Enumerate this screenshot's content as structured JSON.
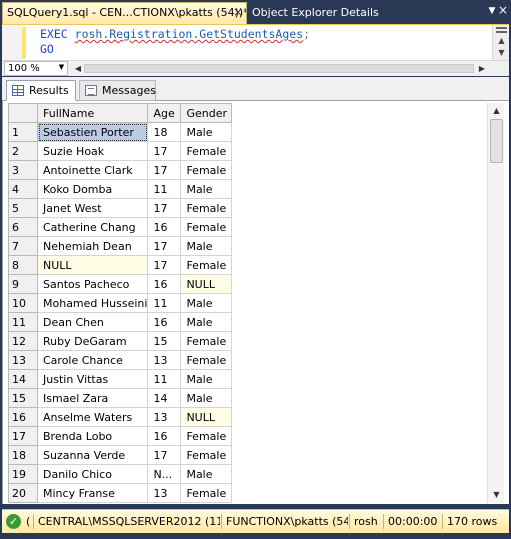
{
  "tabs": {
    "active_label": "SQLQuery1.sql - CEN...CTIONX\\pkatts (54))*",
    "close_glyph": "×",
    "inactive_label": "Object Explorer Details",
    "dropdown_glyph": "▼",
    "closeall_glyph": "×"
  },
  "editor": {
    "line1_keyword": "EXEC",
    "line1_object": "rosh.Registration.GetStudentsAges",
    "line1_terminator": ";",
    "line2_keyword": "GO"
  },
  "zoom": {
    "value": "100 %"
  },
  "results_tabs": {
    "results_label": "Results",
    "messages_label": "Messages"
  },
  "grid": {
    "columns": [
      "FullName",
      "Age",
      "Gender"
    ],
    "rows": [
      {
        "n": "1",
        "name": "Sebastien Porter",
        "age": "18",
        "gender": "Male"
      },
      {
        "n": "2",
        "name": "Suzie Hoak",
        "age": "17",
        "gender": "Female"
      },
      {
        "n": "3",
        "name": "Antoinette Clark",
        "age": "17",
        "gender": "Female"
      },
      {
        "n": "4",
        "name": "Koko Domba",
        "age": "11",
        "gender": "Male"
      },
      {
        "n": "5",
        "name": "Janet West",
        "age": "17",
        "gender": "Female"
      },
      {
        "n": "6",
        "name": "Catherine Chang",
        "age": "16",
        "gender": "Female"
      },
      {
        "n": "7",
        "name": "Nehemiah Dean",
        "age": "17",
        "gender": "Male"
      },
      {
        "n": "8",
        "name": "NULL",
        "age": "17",
        "gender": "Female"
      },
      {
        "n": "9",
        "name": "Santos Pacheco",
        "age": "16",
        "gender": "NULL"
      },
      {
        "n": "10",
        "name": "Mohamed Husseini",
        "age": "11",
        "gender": "Male"
      },
      {
        "n": "11",
        "name": "Dean Chen",
        "age": "16",
        "gender": "Male"
      },
      {
        "n": "12",
        "name": "Ruby DeGaram",
        "age": "15",
        "gender": "Female"
      },
      {
        "n": "13",
        "name": "Carole Chance",
        "age": "13",
        "gender": "Female"
      },
      {
        "n": "14",
        "name": "Justin Vittas",
        "age": "11",
        "gender": "Male"
      },
      {
        "n": "15",
        "name": "Ismael Zara",
        "age": "14",
        "gender": "Male"
      },
      {
        "n": "16",
        "name": "Anselme Waters",
        "age": "13",
        "gender": "NULL"
      },
      {
        "n": "17",
        "name": "Brenda Lobo",
        "age": "16",
        "gender": "Female"
      },
      {
        "n": "18",
        "name": "Suzanna Verde",
        "age": "17",
        "gender": "Female"
      },
      {
        "n": "19",
        "name": "Danilo Chico",
        "age": "N...",
        "gender": "Male"
      },
      {
        "n": "20",
        "name": "Mincy Franse",
        "age": "13",
        "gender": "Female"
      }
    ]
  },
  "status": {
    "paren": "(",
    "server": "CENTRAL\\MSSQLSERVER2012 (11....",
    "login": "FUNCTIONX\\pkatts (54)",
    "database": "rosh",
    "elapsed": "00:00:00",
    "rows": "170 rows",
    "ok_glyph": "✓"
  },
  "colors": {
    "frame": "#293955",
    "tab_active": "#ffe8a6",
    "null_cell": "#fffde6",
    "selected_cell": "#bccbe4",
    "status_ok": "#3b9b2f"
  }
}
